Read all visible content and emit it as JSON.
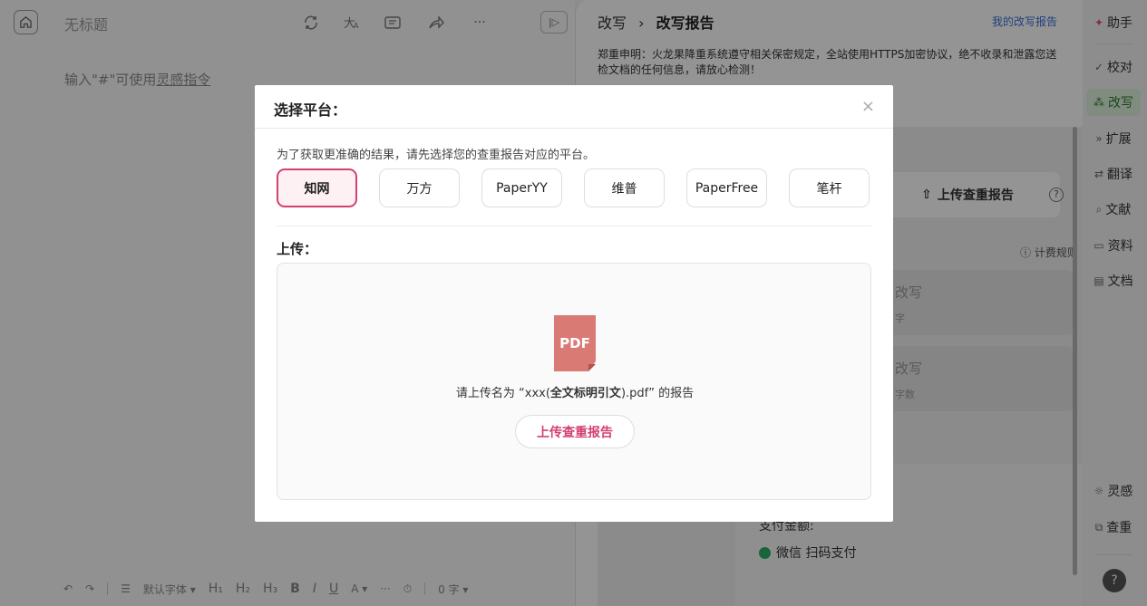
{
  "editor": {
    "title": "无标题",
    "placeholder_prefix": "输入\"#\"可使用",
    "placeholder_link": "灵感指令",
    "toolbar": {
      "font": "默认字体 ▾",
      "h1": "H₁",
      "h2": "H₂",
      "h3": "H₃",
      "bold": "B",
      "italic": "I",
      "underline": "U",
      "color": "A ▾",
      "more": "···",
      "word_count": "0 字 ▾"
    }
  },
  "panel": {
    "breadcrumb_parent": "改写",
    "breadcrumb_sep": "›",
    "breadcrumb_current": "改写报告",
    "my_report_link": "我的改写报告",
    "notice": "郑重申明：火龙果降重系统遵守相关保密规定，全站使用HTTPS加密协议，绝不收录和泄露您送检文档的任何信息，请放心检测！",
    "upload_report": "上传查重报告",
    "billing_rules": "计费规则",
    "card1_title": "改写",
    "card1_sub": "字",
    "card2_title": "改写",
    "card2_sub": "字数",
    "pay_amount_label": "支付金额:",
    "pay_method": "微信 扫码支付"
  },
  "sidebar": {
    "items": [
      {
        "icon": "sparkle-icon",
        "label": "助手"
      },
      {
        "icon": "check-icon",
        "label": "校对"
      },
      {
        "icon": "rewrite-icon",
        "label": "改写"
      },
      {
        "icon": "expand-icon",
        "label": "扩展"
      },
      {
        "icon": "translate-icon",
        "label": "翻译"
      },
      {
        "icon": "search-icon",
        "label": "文献"
      },
      {
        "icon": "inbox-icon",
        "label": "资料"
      },
      {
        "icon": "document-icon",
        "label": "文档"
      },
      {
        "icon": "bulb-icon",
        "label": "灵感"
      },
      {
        "icon": "duplicate-icon",
        "label": "查重"
      }
    ],
    "active": "改写",
    "help": "?"
  },
  "dialog": {
    "title": "选择平台：",
    "close": "×",
    "tip": "为了获取更准确的结果，请先选择您的查重报告对应的平台。",
    "platforms": [
      "知网",
      "万方",
      "PaperYY",
      "维普",
      "PaperFree",
      "笔杆"
    ],
    "selected_platform": "知网",
    "upload_label": "上传：",
    "pdf_label": "PDF",
    "hint_prefix": "请上传名为 “xxx(",
    "hint_bold": "全文标明引文",
    "hint_suffix": ").pdf” 的报告",
    "upload_button": "上传查重报告"
  },
  "colors": {
    "accent": "#d4416f",
    "active_green": "#2e7d32",
    "pdf": "#d97a75",
    "link_blue": "#3a6fd8"
  }
}
